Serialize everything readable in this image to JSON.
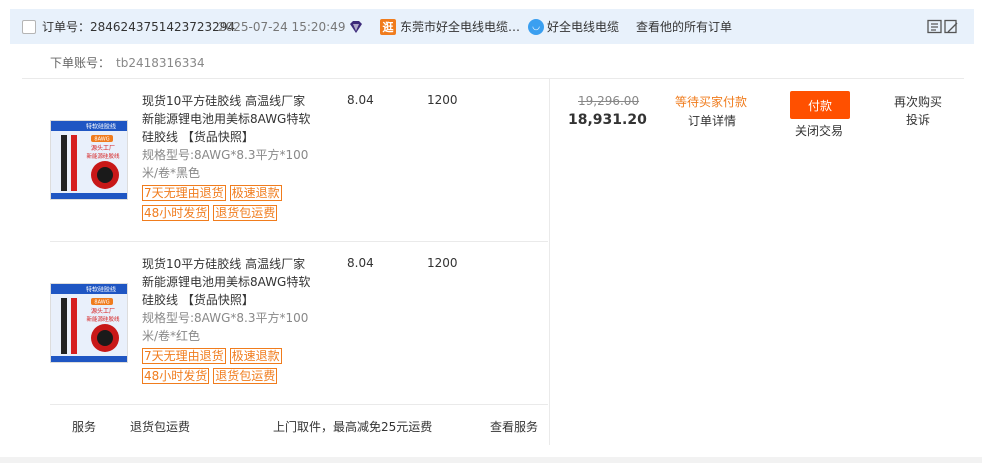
{
  "order": {
    "number_label": "订单号：",
    "number": "2846243751423723294",
    "date": "2025-07-24 15:20:49",
    "shop_name": "东莞市好全电线电缆…",
    "shop_icon_char": "逛",
    "seller_name": "好全电线电缆",
    "view_all": "查看他的所有订单",
    "account_label": "下单账号：",
    "account": "tb2418316334"
  },
  "items": [
    {
      "title": "现货10平方硅胶线 高温线厂家新能源锂电池用美标8AWG特软硅胶线 【货品快照】",
      "spec": "规格型号:8AWG*8.3平方*100米/卷*黑色",
      "unit_price": "8.04",
      "quantity": "1200",
      "tags_row1": [
        "7天无理由退货",
        "极速退款"
      ],
      "tags_row2": [
        "48小时发货",
        "退货包运费"
      ],
      "cable_color": "#222222"
    },
    {
      "title": "现货10平方硅胶线 高温线厂家新能源锂电池用美标8AWG特软硅胶线 【货品快照】",
      "spec": "规格型号:8AWG*8.3平方*100米/卷*红色",
      "unit_price": "8.04",
      "quantity": "1200",
      "tags_row1": [
        "7天无理由退货",
        "极速退款"
      ],
      "tags_row2": [
        "48小时发货",
        "退货包运费"
      ],
      "cable_color": "#d62020"
    }
  ],
  "thumb": {
    "banner": "特软硅胶线",
    "badge": "8AWG",
    "tagline1": "源头工厂",
    "tagline2": "新能源硅胶线"
  },
  "summary": {
    "original_total": "19,296.00",
    "paid_total": "18,931.20",
    "status": "等待买家付款",
    "detail_link": "订单详情",
    "pay_button": "付款",
    "close_link": "关闭交易",
    "rebuy_link": "再次购买",
    "complain_link": "投诉"
  },
  "service": {
    "label": "服务",
    "name": "退货包运费",
    "desc": "上门取件，最高减免25元运费",
    "link": "查看服务"
  },
  "colors": {
    "accent": "#ff5000",
    "tag_orange": "#f07c1d",
    "header_bg": "#e8f1fb"
  }
}
